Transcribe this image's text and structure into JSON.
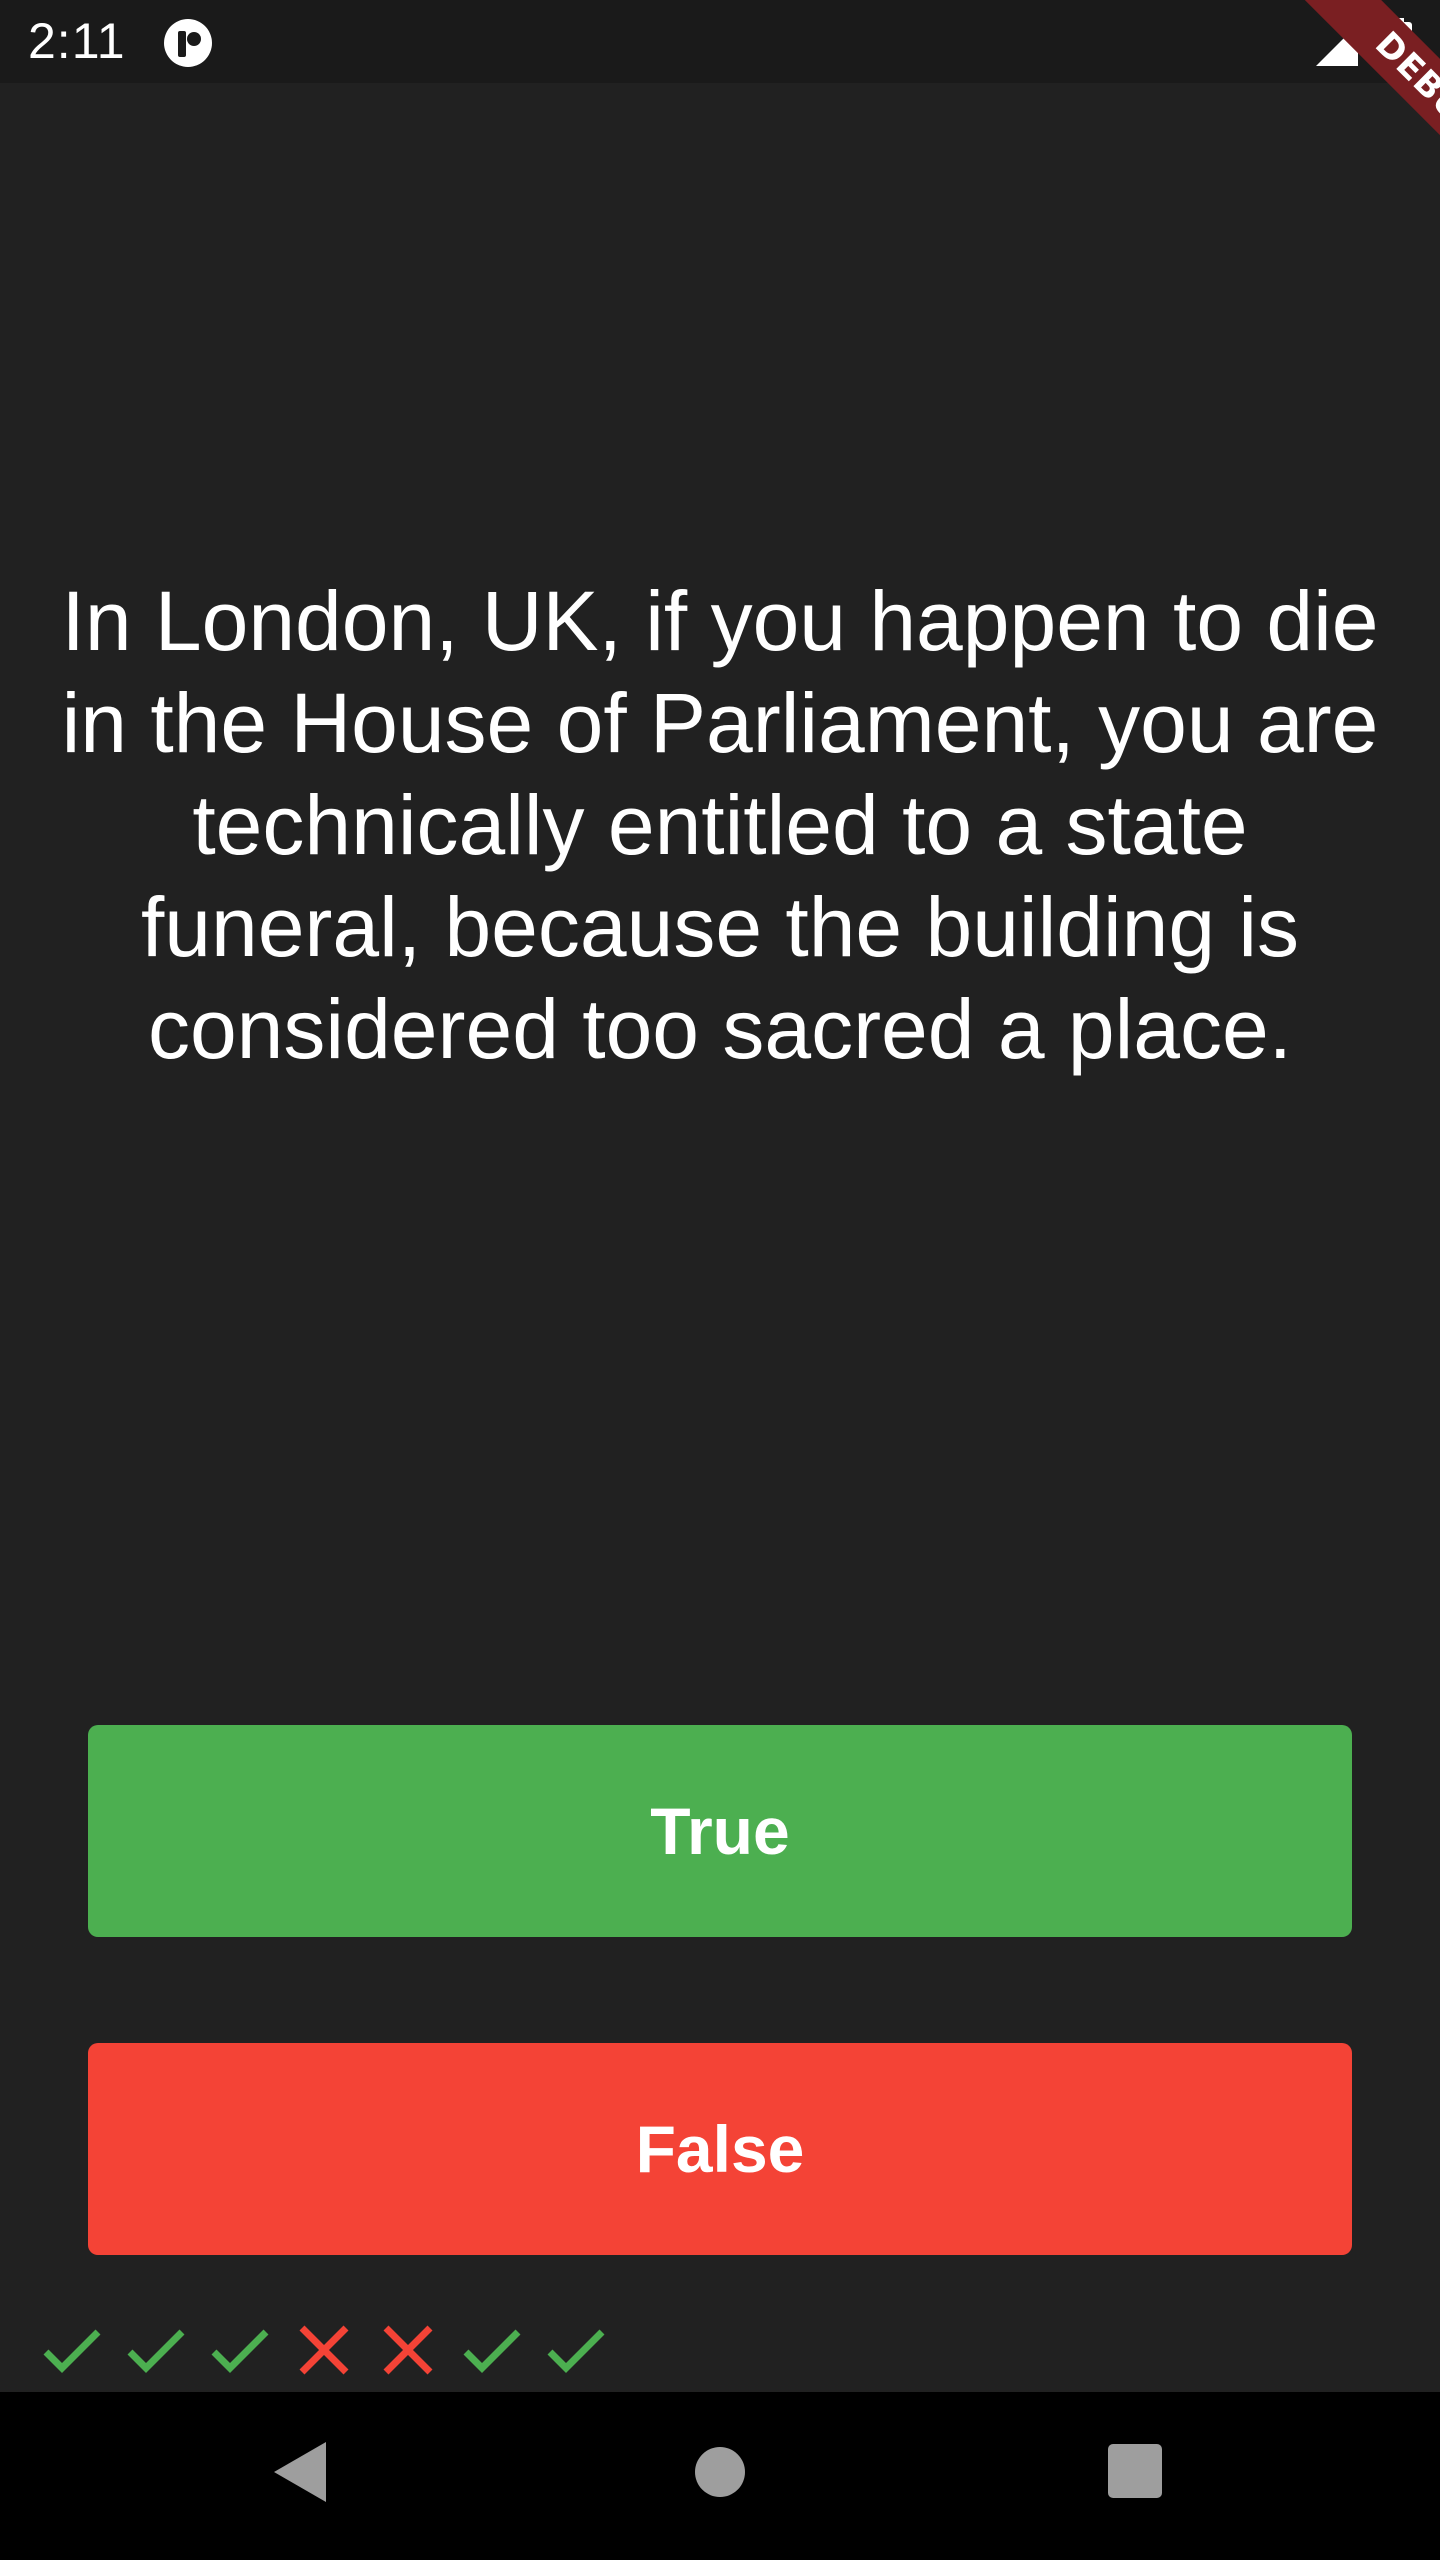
{
  "status_bar": {
    "time": "2:11"
  },
  "debug_banner": {
    "label": "DEBUG"
  },
  "question": {
    "text": "In London, UK, if you happen to die in the House of Parliament, you are technically entitled to a state funeral, because the building is considered too sacred a place."
  },
  "buttons": {
    "true_label": "True",
    "false_label": "False"
  },
  "score": {
    "results": [
      "correct",
      "correct",
      "correct",
      "wrong",
      "wrong",
      "correct",
      "correct"
    ]
  },
  "colors": {
    "background": "#212121",
    "true_button": "#4caf50",
    "false_button": "#f44336",
    "check_icon": "#4caf50",
    "cross_icon": "#f44336",
    "debug_ribbon": "#7a1f22"
  },
  "icons": {
    "status": [
      "app-indicator-icon",
      "signal-icon",
      "battery-icon"
    ],
    "score": [
      "check-icon",
      "close-icon"
    ],
    "nav": [
      "back-icon",
      "home-icon",
      "recents-icon"
    ]
  }
}
